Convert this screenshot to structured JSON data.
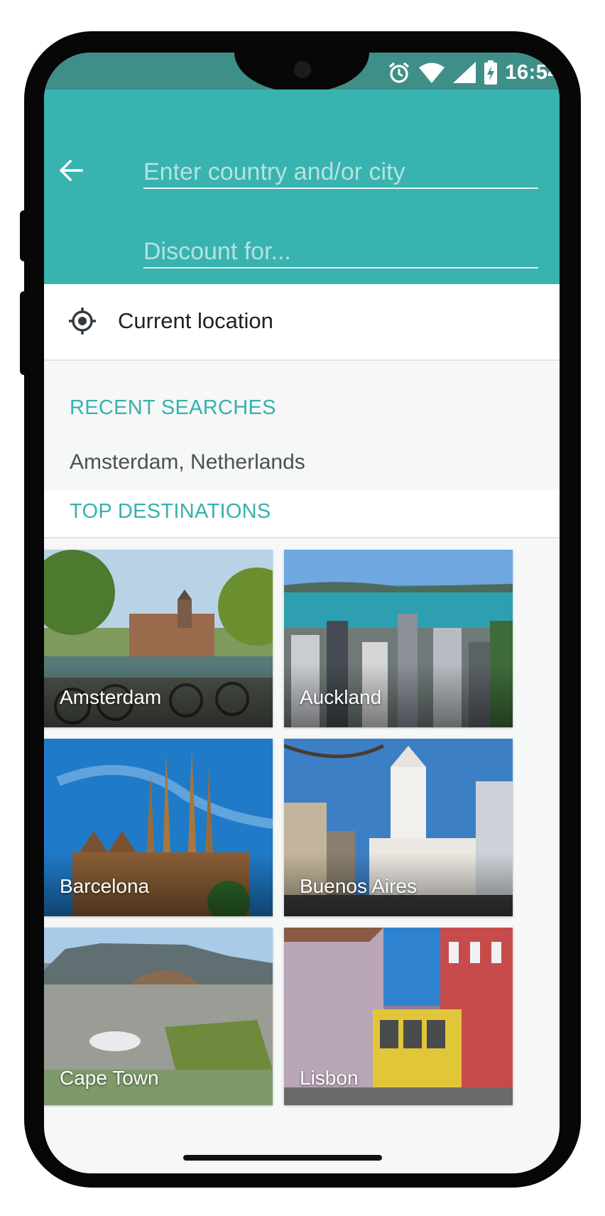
{
  "status_bar": {
    "time": "16:54",
    "icons": [
      "alarm-icon",
      "wifi-icon",
      "cell-signal-icon",
      "battery-charging-icon"
    ]
  },
  "search": {
    "back_icon": "arrow-left-icon",
    "destination_placeholder": "Enter country and/or city",
    "destination_value": "",
    "discount_placeholder": "Discount for...",
    "discount_value": ""
  },
  "current_location": {
    "icon": "gps-target-icon",
    "label": "Current location"
  },
  "recent_searches": {
    "title": "RECENT SEARCHES",
    "items": [
      "Amsterdam, Netherlands"
    ]
  },
  "top_destinations": {
    "title": "TOP DESTINATIONS",
    "items": [
      {
        "name": "Amsterdam"
      },
      {
        "name": "Auckland"
      },
      {
        "name": "Barcelona"
      },
      {
        "name": "Buenos Aires"
      },
      {
        "name": "Cape Town"
      },
      {
        "name": "Lisbon"
      }
    ]
  },
  "colors": {
    "primary": "#39b3b0",
    "status_bar": "#3f8f89",
    "accent_text": "#38b1ad",
    "background": "#f6f7f7"
  }
}
